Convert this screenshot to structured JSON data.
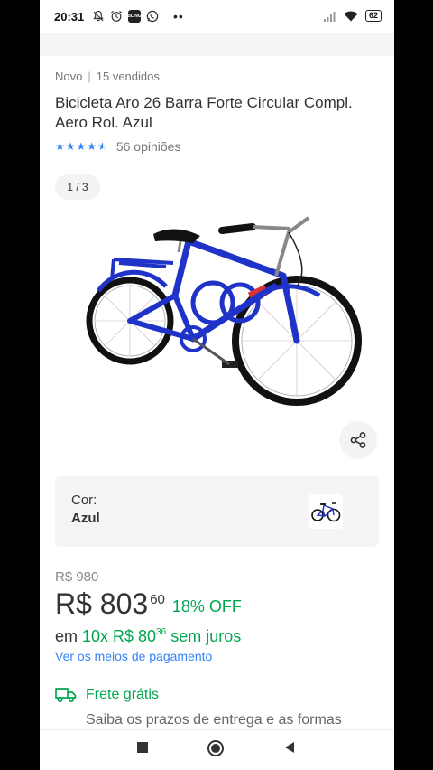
{
  "status_bar": {
    "time": "20:31",
    "app_badge": "BLING",
    "battery": "62"
  },
  "product": {
    "condition": "Novo",
    "sold": "15 vendidos",
    "title": "Bicicleta Aro 26 Barra Forte Circular Compl. Aero Rol. Azul",
    "rating_value": 4.5,
    "reviews": "56 opiniões",
    "image_counter": "1 / 3",
    "image_icon": "bicycle-image"
  },
  "variant": {
    "label": "Cor:",
    "value": "Azul"
  },
  "pricing": {
    "old_price": "R$ 980",
    "price": "R$ 803",
    "cents": "60",
    "discount": "18% OFF",
    "installments_prefix": "em ",
    "installments_value": "10x R$ 80",
    "installments_cents": "36",
    "installments_suffix": " sem juros",
    "payment_link": "Ver os meios de pagamento"
  },
  "shipping": {
    "title": "Frete grátis",
    "subtitle": "Saiba os prazos de entrega e as formas"
  },
  "colors": {
    "accent_blue": "#3483fa",
    "green": "#00a650",
    "bike_blue": "#1f33c8"
  }
}
